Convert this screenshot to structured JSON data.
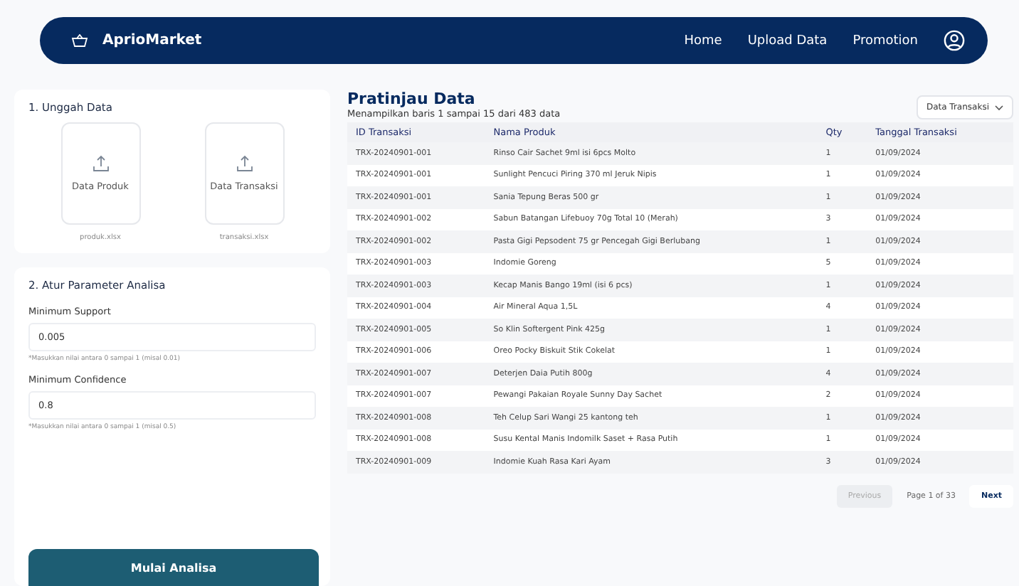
{
  "navbar": {
    "brand": "AprioMarket",
    "links": [
      {
        "label": "Home",
        "selected": false
      },
      {
        "label": "Upload Data",
        "selected": false
      },
      {
        "label": "Promotion",
        "selected": false
      }
    ]
  },
  "upload": {
    "title": "1. Unggah Data",
    "cards": [
      {
        "label": "Data Produk",
        "file": "produk.xlsx"
      },
      {
        "label": "Data Transaksi",
        "file": "transaksi.xlsx"
      }
    ]
  },
  "parameters": {
    "title": "2. Atur Parameter Analisa",
    "fields": [
      {
        "label": "Minimum Support",
        "value": "0.005",
        "hint": "*Masukkan nilai antara 0 sampai 1 (misal 0.01)"
      },
      {
        "label": "Minimum Confidence",
        "value": "0.8",
        "hint": "*Masukkan nilai antara 0 sampai 1 (misal 0.5)"
      }
    ],
    "button": "Mulai Analisa"
  },
  "preview": {
    "title": "Pratinjau Data",
    "subtitle": "Menampilkan baris 1 sampai 15 dari 483 data",
    "dropdown": "Data Transaksi",
    "columns": [
      "ID Transaksi",
      "Nama Produk",
      "Qty",
      "Tanggal Transaksi"
    ],
    "rows": [
      [
        "TRX-20240901-001",
        "Rinso Cair Sachet 9ml isi 6pcs Molto",
        "1",
        "01/09/2024"
      ],
      [
        "TRX-20240901-001",
        "Sunlight Pencuci Piring 370 ml Jeruk Nipis",
        "1",
        "01/09/2024"
      ],
      [
        "TRX-20240901-001",
        "Sania Tepung Beras 500 gr",
        "1",
        "01/09/2024"
      ],
      [
        "TRX-20240901-002",
        "Sabun Batangan Lifebuoy 70g Total 10 (Merah)",
        "3",
        "01/09/2024"
      ],
      [
        "TRX-20240901-002",
        "Pasta Gigi Pepsodent 75 gr Pencegah Gigi Berlubang",
        "1",
        "01/09/2024"
      ],
      [
        "TRX-20240901-003",
        "Indomie Goreng",
        "5",
        "01/09/2024"
      ],
      [
        "TRX-20240901-003",
        "Kecap Manis Bango 19ml (isi 6 pcs)",
        "1",
        "01/09/2024"
      ],
      [
        "TRX-20240901-004",
        "Air Mineral Aqua 1,5L",
        "4",
        "01/09/2024"
      ],
      [
        "TRX-20240901-005",
        "So Klin Softergent Pink 425g",
        "1",
        "01/09/2024"
      ],
      [
        "TRX-20240901-006",
        "Oreo Pocky Biskuit Stik Cokelat",
        "1",
        "01/09/2024"
      ],
      [
        "TRX-20240901-007",
        "Deterjen Daia Putih 800g",
        "4",
        "01/09/2024"
      ],
      [
        "TRX-20240901-007",
        "Pewangi Pakaian Royale Sunny Day Sachet",
        "2",
        "01/09/2024"
      ],
      [
        "TRX-20240901-008",
        "Teh Celup Sari Wangi 25 kantong teh",
        "1",
        "01/09/2024"
      ],
      [
        "TRX-20240901-008",
        "Susu Kental Manis Indomilk Saset + Rasa Putih",
        "1",
        "01/09/2024"
      ],
      [
        "TRX-20240901-009",
        "Indomie Kuah Rasa Kari Ayam",
        "3",
        "01/09/2024"
      ]
    ],
    "pagination": {
      "previous": {
        "label": "Previous",
        "disabled": true
      },
      "page": "Page 1 of 33",
      "next": {
        "label": "Next",
        "disabled": false
      }
    }
  }
}
